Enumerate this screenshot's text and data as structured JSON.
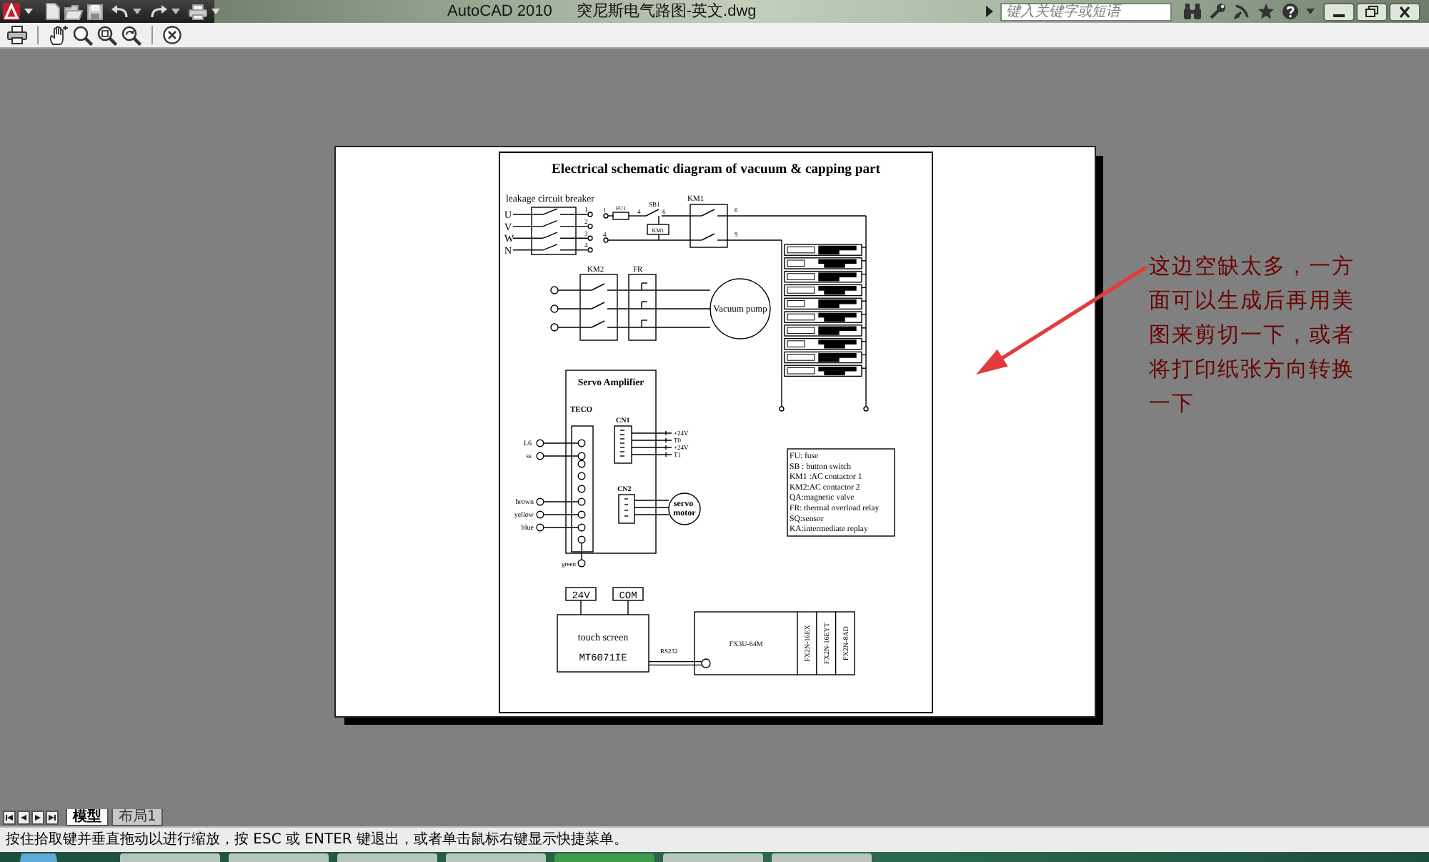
{
  "title_bar": {
    "app_name": "AutoCAD 2010",
    "document": "突尼斯电气路图-英文.dwg",
    "search": {
      "placeholder": "键入关键字或短语"
    }
  },
  "drawing": {
    "title": "Electrical schematic diagram of vacuum & capping part",
    "breaker": {
      "label": "leakage circuit breaker",
      "phases": [
        "U",
        "V",
        "W",
        "N"
      ],
      "terminals": [
        "1",
        "2",
        "3",
        "4"
      ]
    },
    "control_circuit": {
      "terminals": [
        "1",
        "4"
      ],
      "fuse": "FU1",
      "switch": "SB1",
      "switch_wires": [
        "4",
        "6"
      ],
      "coil": "KM1",
      "contactor": "KM1",
      "outputs": [
        "6",
        "9"
      ]
    },
    "pump_circuit": {
      "contactor": "KM2",
      "relay": "FR",
      "motor": "Vacuum pump"
    },
    "servo_amplifier": {
      "title": "Servo Amplifier",
      "brand": "TECO",
      "inputs": [
        "L6",
        "ss"
      ],
      "motor_wires": [
        "brown",
        "yellow",
        "blue"
      ],
      "ground": "green",
      "cn1": {
        "label": "CN1",
        "signals": [
          "+24V",
          "T0",
          "+24V",
          "T1"
        ]
      },
      "cn2": {
        "label": "CN2",
        "motor": "servo motor"
      }
    },
    "legend": [
      "FU: fuse",
      "SB : button switch",
      "KM1 :AC contactor 1",
      "KM2:AC contactor 2",
      "QA:magnetic valve",
      "FR: thermal overload relay",
      "SQ:sensor",
      "KA:intermediate replay"
    ],
    "touch_screen": {
      "supplies": [
        "24V",
        "COM"
      ],
      "name": "touch screen",
      "model": "MT6071IE",
      "link": "RS232"
    },
    "plc": {
      "model": "FX3U-64M",
      "modules": [
        "FX2N-16EX",
        "FX2N-16EYT",
        "FX2N-8AD"
      ]
    }
  },
  "annotation": {
    "text": "这边空缺太多，一方面可以生成后再用美图来剪切一下，或者将打印纸张方向转换一下"
  },
  "layout_tabs": [
    {
      "label": "模型",
      "selected": true
    },
    {
      "label": "布局1",
      "selected": false
    }
  ],
  "status_bar": {
    "prompt": "按住拾取键并垂直拖动以进行缩放，按 ESC 或 ENTER 键退出，或者单击鼠标右键显示快捷菜单。"
  }
}
